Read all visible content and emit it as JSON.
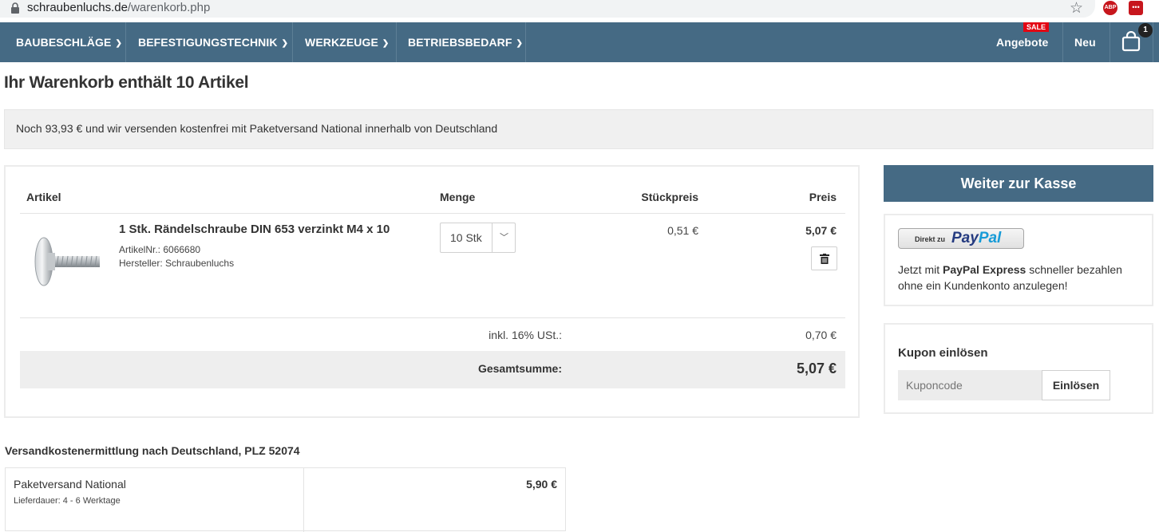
{
  "browser": {
    "url_domain": "schraubenluchs.de",
    "url_path": "/warenkorb.php",
    "ext_abp": "ABP",
    "ext_other": "•••"
  },
  "nav": {
    "items": [
      {
        "label": "BAUBESCHLÄGE"
      },
      {
        "label": "BEFESTIGUNGSTECHNIK"
      },
      {
        "label": "WERKZEUGE"
      },
      {
        "label": "BETRIEBSBEDARF"
      }
    ],
    "sale_badge": "SALE",
    "offers": "Angebote",
    "new": "Neu",
    "cart_count": "1"
  },
  "page": {
    "title": "Ihr Warenkorb enthält 10 Artikel",
    "shipping_notice": "Noch 93,93 € und wir versenden kostenfrei mit Paketversand National innerhalb von Deutschland"
  },
  "cart": {
    "headers": {
      "article": "Artikel",
      "qty": "Menge",
      "unit_price": "Stückpreis",
      "price": "Preis"
    },
    "item": {
      "name": "1 Stk. Rändelschraube DIN 653 verzinkt M4 x 10",
      "article_no": "ArtikelNr.: 6066680",
      "manufacturer": "Hersteller: Schraubenluchs",
      "qty": "10 Stk",
      "unit_price": "0,51 €",
      "price": "5,07 €"
    },
    "tax_label": "inkl. 16% USt.:",
    "tax_value": "0,70 €",
    "total_label": "Gesamtsumme:",
    "total_value": "5,07 €"
  },
  "checkout": {
    "label": "Weiter zur Kasse"
  },
  "paypal": {
    "btn_prefix": "Direkt zu",
    "btn_pay": "Pay",
    "btn_pal": "Pal",
    "text_pre": "Jetzt mit ",
    "text_bold": "PayPal Express",
    "text_post": " schneller bezahlen ohne ein Kundenkonto anzulegen!"
  },
  "coupon": {
    "title": "Kupon einlösen",
    "placeholder": "Kuponcode",
    "button": "Einlösen"
  },
  "shipping": {
    "title": "Versandkostenermittlung nach Deutschland, PLZ 52074",
    "method": "Paketversand National",
    "delivery": "Lieferdauer: 4 - 6 Werktage",
    "price": "5,90 €"
  },
  "colors": {
    "nav": "#456a84",
    "sale": "#e30613",
    "paypal_dark": "#253b80",
    "paypal_light": "#179bd7"
  }
}
